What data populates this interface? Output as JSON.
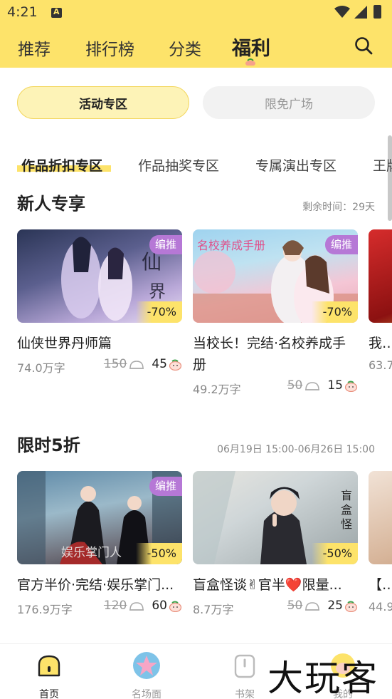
{
  "status_bar": {
    "time": "4:21"
  },
  "nav": {
    "tabs": [
      {
        "label": "推荐"
      },
      {
        "label": "排行榜"
      },
      {
        "label": "分类"
      },
      {
        "label": "福利"
      }
    ],
    "active_tab": "福利"
  },
  "segments": {
    "left": "活动专区",
    "right": "限免广场"
  },
  "categories": [
    "作品折扣专区",
    "作品抽奖专区",
    "专属演出专区",
    "王牌"
  ],
  "sections": [
    {
      "title": "新人专享",
      "meta": "剩余时间：29天",
      "cards": [
        {
          "badge": "编推",
          "discount": "-70%",
          "title": "仙侠世界丹师篇",
          "words": "74.0万字",
          "old_price": "150",
          "new_price": "45"
        },
        {
          "badge": "编推",
          "discount": "-70%",
          "title": "当校长！完结·名校养成手册",
          "words": "49.2万字",
          "old_price": "50",
          "new_price": "15"
        },
        {
          "title": "我的",
          "words": "63.7"
        }
      ]
    },
    {
      "title": "限时5折",
      "meta": "06月19日 15:00-06月26日 15:00",
      "cards": [
        {
          "badge": "编推",
          "discount": "-50%",
          "title": "官方半价·完结·娱乐掌门...",
          "words": "176.9万字",
          "old_price": "120",
          "new_price": "60"
        },
        {
          "discount": "-50%",
          "title": "盲盒怪谈✌官半❤️限量...",
          "words": "8.7万字",
          "old_price": "50",
          "new_price": "25"
        },
        {
          "title": "【拍",
          "words": "44.9"
        }
      ]
    }
  ],
  "bottom_nav": [
    {
      "label": "首页",
      "active": true
    },
    {
      "label": "名场面"
    },
    {
      "label": "书架"
    },
    {
      "label": "我的"
    }
  ],
  "watermark": "大玩客",
  "colors": {
    "accent": "#fde36a",
    "badge": "#b678d6",
    "segment_on": "#fdf3b7"
  }
}
